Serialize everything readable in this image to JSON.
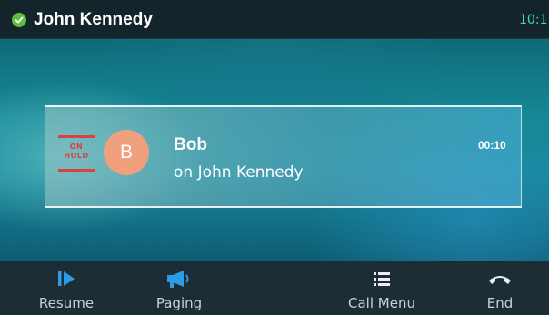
{
  "status_bar": {
    "user_name": "John Kennedy",
    "time": "10:1",
    "status_icon": "check-circle-icon",
    "status_color": "#5fbf3b"
  },
  "call": {
    "hold_badge": "ON HOLD",
    "avatar_initial": "B",
    "caller_name": "Bob",
    "line_text": "on John Kennedy",
    "timer": "00:10",
    "avatar_color": "#f1a07e",
    "hold_color": "#d8423f"
  },
  "softkeys": [
    {
      "label": "Resume",
      "icon": "resume-icon"
    },
    {
      "label": "Paging",
      "icon": "megaphone-icon"
    },
    {
      "label": "Call Menu",
      "icon": "menu-list-icon"
    },
    {
      "label": "End",
      "icon": "hang-up-icon"
    }
  ],
  "colors": {
    "accent_blue": "#2f9be6",
    "label_gray": "#c6d2d8"
  }
}
